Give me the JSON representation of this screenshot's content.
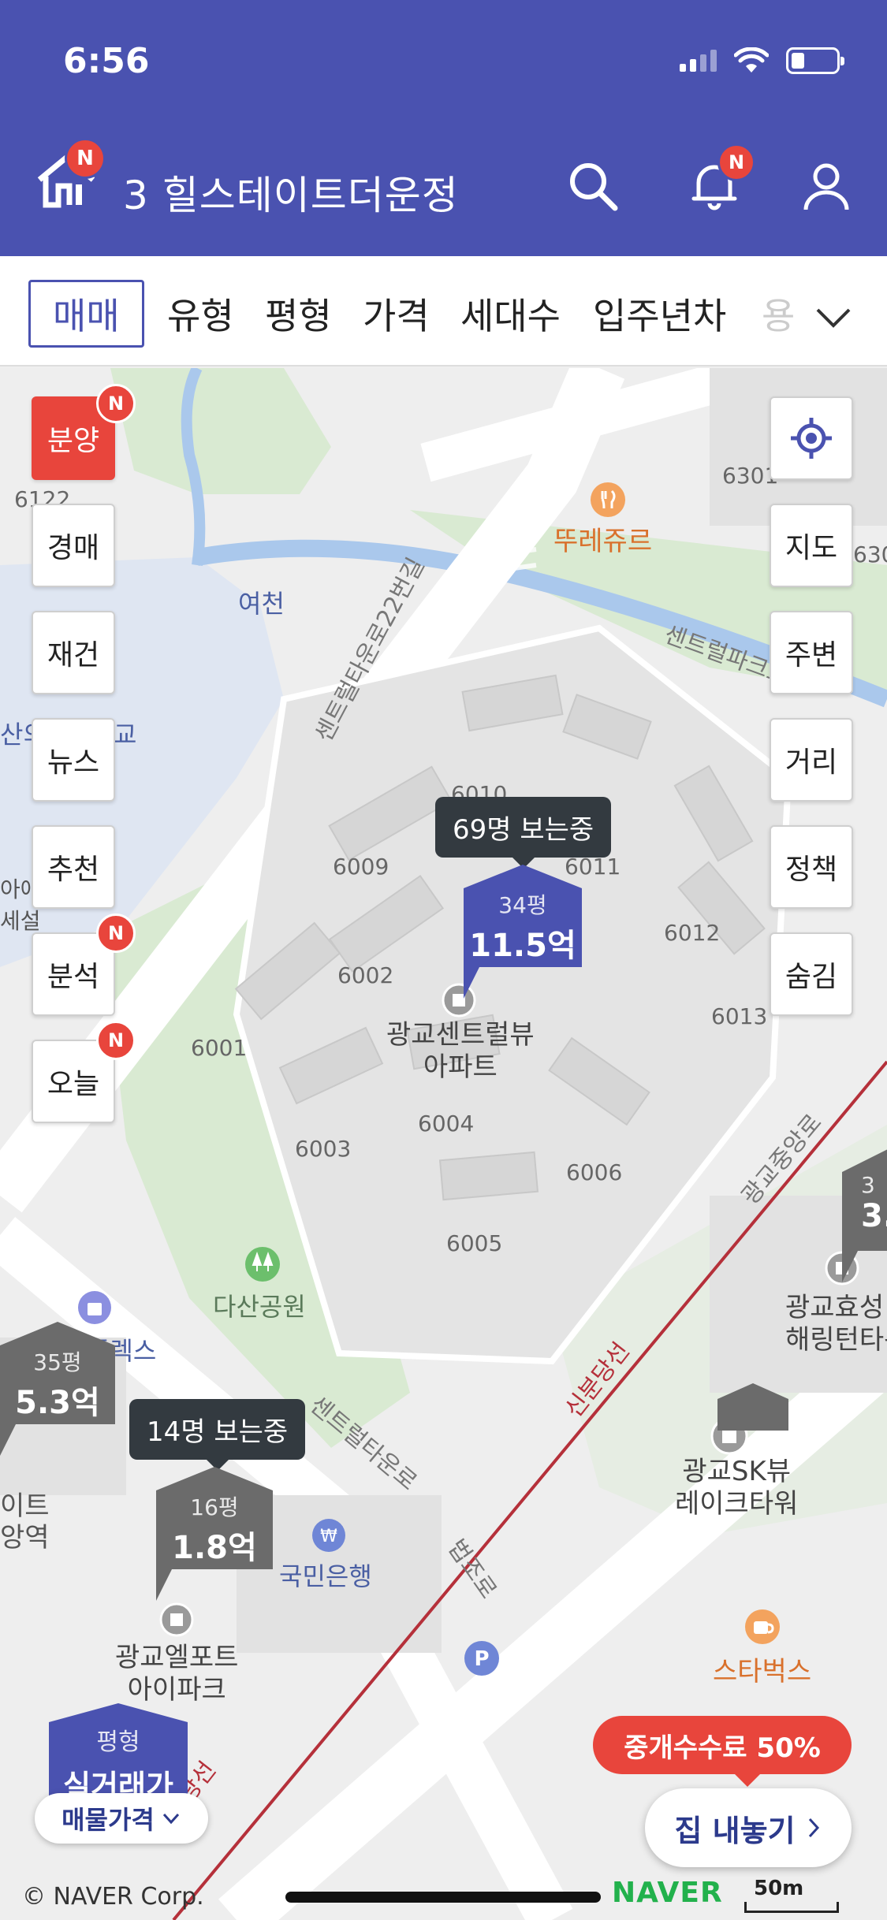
{
  "status": {
    "time": "6:56"
  },
  "header": {
    "title": "3  힐스테이트더운정",
    "logo_badge": "N",
    "bell_badge": "N"
  },
  "filters": {
    "tabs": [
      "매매",
      "유형",
      "평형",
      "가격",
      "세대수",
      "입주년차",
      "용"
    ],
    "active": "매매"
  },
  "left_buttons": [
    {
      "label": "분양",
      "badge": "N",
      "highlight": true
    },
    {
      "label": "경매",
      "badge": ""
    },
    {
      "label": "재건",
      "badge": ""
    },
    {
      "label": "뉴스",
      "badge": ""
    },
    {
      "label": "추천",
      "badge": ""
    },
    {
      "label": "분석",
      "badge": "N"
    },
    {
      "label": "오늘",
      "badge": "N"
    }
  ],
  "right_buttons": [
    "지도",
    "주변",
    "거리",
    "정책",
    "숨김"
  ],
  "map_labels": {
    "restaurant": "뚜레쥬르",
    "river": "여천",
    "road1": "센트럴타운로22번길",
    "road2": "센트럴파크로",
    "road3": "센트럴타운로",
    "road4": "법조로",
    "rail": "신분당선",
    "rail_short": "당선",
    "road5": "광교중앙로",
    "apt_main": "광교센트럴뷰\n아파트",
    "park": "다산공원",
    "bank": "국민은행",
    "apt_sw": "광교엘포트\n아이파크",
    "sk": "광교SK뷰\n레이크타워",
    "starbucks": "스타벅스",
    "hyosung": "광교효성\n해링턴타워",
    "plex": "플렉스",
    "edge_left1": "산의",
    "edge_left1b": "교",
    "edge_left2": "아애",
    "edge_left2b": "세설",
    "edge_left3": "이트",
    "edge_left3b": "앙역",
    "block_6122": "6122",
    "block_6301": "6301",
    "block_6302": "630",
    "blocks": [
      "6010",
      "6011",
      "6009",
      "6012",
      "6002",
      "6013",
      "6001",
      "6004",
      "6003",
      "6006",
      "6005"
    ]
  },
  "markers": {
    "main": {
      "viewers": "69명 보는중",
      "size": "34평",
      "price": "11.5억"
    },
    "left": {
      "size": "35평",
      "price": "5.3억"
    },
    "sw": {
      "viewers": "14명 보는중",
      "size": "16평",
      "price": "1.8억"
    },
    "right": {
      "size": "3",
      "price": "3."
    }
  },
  "legend": {
    "top": "평형",
    "bottom": "실거래가"
  },
  "price_select": "매물가격",
  "promo": "중개수수료 50%",
  "list_button": "집 내놓기",
  "copyright": "© NAVER Corp.",
  "brand": "NAVER",
  "scale": "50m",
  "colors": {
    "brand": "#4a52b0",
    "alert": "#e8453c",
    "marker_gray": "#6b6b6b"
  }
}
